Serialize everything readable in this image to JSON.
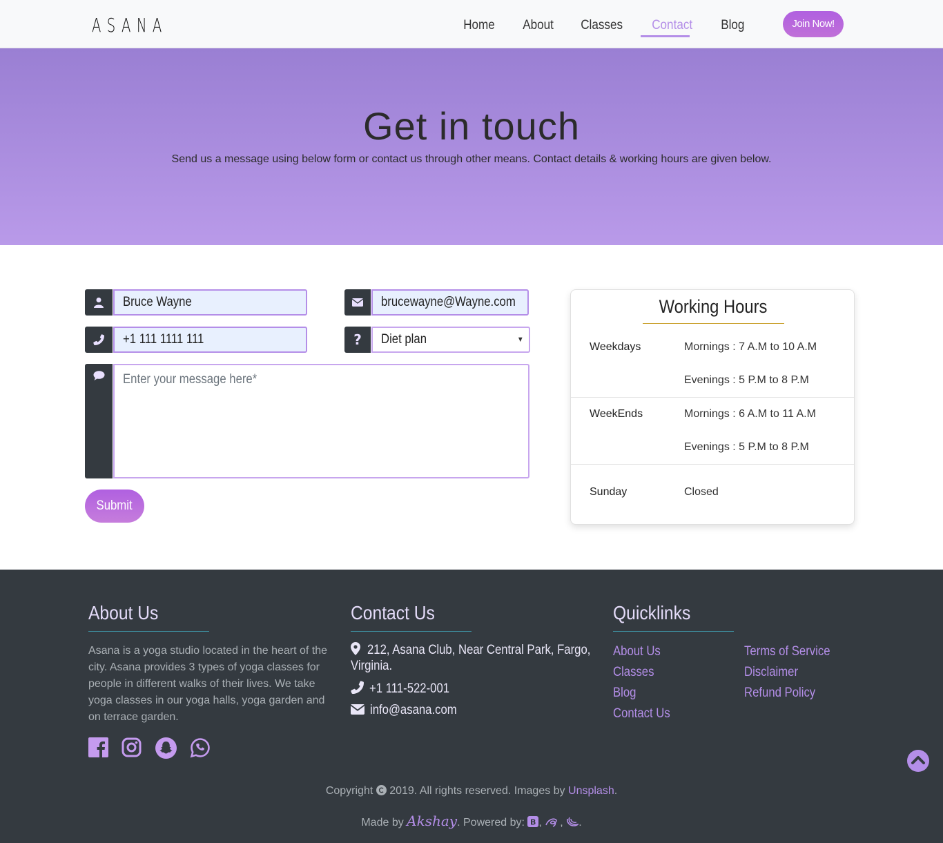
{
  "nav": {
    "brand": "ASANA",
    "links": [
      "Home",
      "About",
      "Classes",
      "Contact",
      "Blog"
    ],
    "active": "Contact",
    "join_label": "Join Now!"
  },
  "hero": {
    "title": "Get in touch",
    "subtitle": "Send us a message using below form or contact us through other means. Contact details & working hours are given below."
  },
  "form": {
    "name_value": "Bruce Wayne",
    "email_value": "brucewayne@Wayne.com",
    "phone_value": "+1 111 1111 111",
    "subject_value": "Diet plan",
    "message_placeholder": "Enter your message here*",
    "submit_label": "Submit"
  },
  "hours": {
    "title": "Working Hours",
    "rows": [
      {
        "day": "Weekdays",
        "morning": "Mornings : 7 A.M to 10 A.M",
        "evening": "Evenings : 5 P.M to 8 P.M"
      },
      {
        "day": "WeekEnds",
        "morning": "Mornings : 6 A.M to 11 A.M",
        "evening": "Evenings : 5 P.M to 8 P.M"
      },
      {
        "day": "Sunday",
        "status": "Closed"
      }
    ]
  },
  "footer": {
    "about_title": "About Us",
    "about_text": "Asana is a yoga studio located in the heart of the city. Asana provides 3 types of yoga classes for people in different walks of their lives. We take yoga classes in our yoga halls, yoga garden and on terrace garden.",
    "contact_title": "Contact Us",
    "address_line1": "212, Asana Club, Near Central Park, Fargo,",
    "address_line2": "Virginia.",
    "phone": "+1 111-522-001",
    "email": "info@asana.com",
    "quicklinks_title": "Quicklinks",
    "quicklinks_col1": [
      "About Us",
      "Classes",
      "Blog",
      "Contact Us"
    ],
    "quicklinks_col2": [
      "Terms of Service",
      "Disclaimer",
      "Refund Policy"
    ],
    "copyright_pre": "Copyright",
    "copyright_mid": "2019. All rights reserved. Images by",
    "copyright_link": "Unsplash",
    "made_by_pre": "Made by",
    "made_by_name": "Akshay",
    "powered_by": ". Powered by:"
  },
  "colors": {
    "accent": "#b48ee8",
    "dark": "#343a40",
    "hero_top": "#9a7fd3",
    "hero_bottom": "#b99ae9"
  },
  "icons": [
    "user-icon",
    "envelope-icon",
    "phone-icon",
    "question-icon",
    "comment-icon",
    "map-marker-icon",
    "facebook-icon",
    "instagram-icon",
    "snapchat-icon",
    "whatsapp-icon",
    "copyright-icon",
    "bootstrap-icon",
    "sass-icon",
    "jquery-icon",
    "chevron-up-icon"
  ]
}
